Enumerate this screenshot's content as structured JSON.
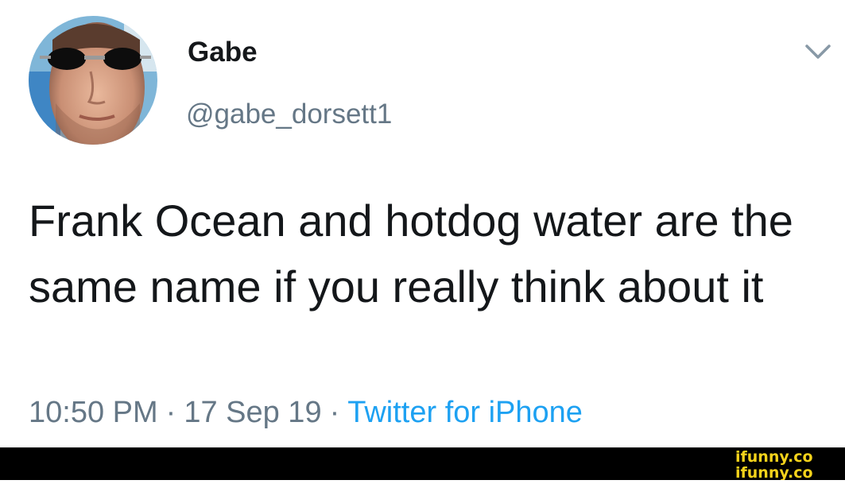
{
  "tweet": {
    "author": {
      "display_name": "Gabe",
      "handle": "@gabe_dorsett1"
    },
    "body": "Frank Ocean and hotdog water are the same name if you really think about it",
    "timestamp": {
      "time": "10:50 PM",
      "date": "17 Sep 19",
      "source": "Twitter for iPhone",
      "separator": "·"
    },
    "menu_icon": "chevron-down-icon"
  },
  "watermark": {
    "text": "ifunny.co",
    "color": "#f5d31b"
  },
  "colors": {
    "text_primary": "#14171a",
    "text_secondary": "#657786",
    "link": "#1da1f2"
  }
}
